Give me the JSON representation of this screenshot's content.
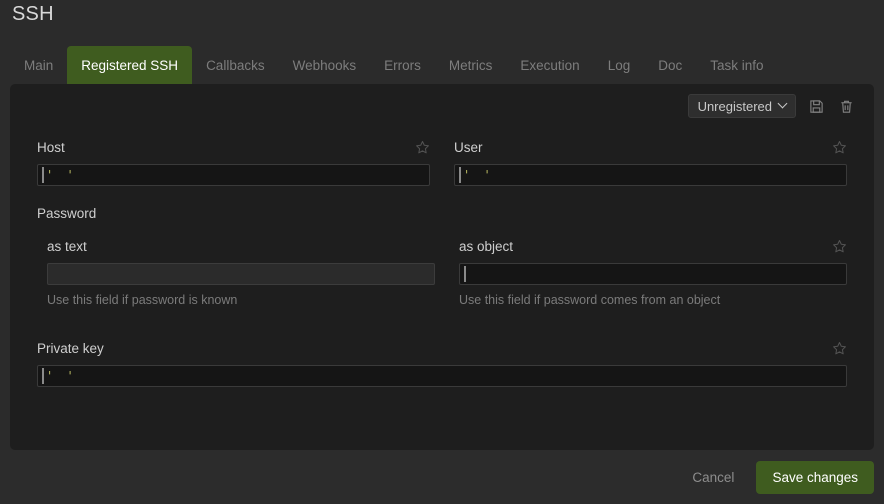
{
  "header": {
    "title": "SSH"
  },
  "tabs": [
    {
      "label": "Main",
      "active": false
    },
    {
      "label": "Registered SSH",
      "active": true
    },
    {
      "label": "Callbacks",
      "active": false
    },
    {
      "label": "Webhooks",
      "active": false
    },
    {
      "label": "Errors",
      "active": false
    },
    {
      "label": "Metrics",
      "active": false
    },
    {
      "label": "Execution",
      "active": false
    },
    {
      "label": "Log",
      "active": false
    },
    {
      "label": "Doc",
      "active": false
    },
    {
      "label": "Task info",
      "active": false
    }
  ],
  "toolbar": {
    "select_value": "Unregistered",
    "select_options": [
      "Unregistered"
    ],
    "save_icon": "floppy-disk-icon",
    "delete_icon": "trash-icon",
    "chevron_icon": "chevron-down-icon"
  },
  "form": {
    "host": {
      "label": "Host",
      "value": "' '",
      "favorite_icon": "star-outline-icon"
    },
    "user": {
      "label": "User",
      "value": "' '",
      "favorite_icon": "star-outline-icon"
    },
    "password": {
      "section_label": "Password",
      "as_text": {
        "label": "as text",
        "value": "",
        "placeholder": "",
        "helper": "Use this field if password is known"
      },
      "as_object": {
        "label": "as object",
        "value": "",
        "helper": "Use this field if password comes from an object",
        "favorite_icon": "star-outline-icon"
      }
    },
    "private_key": {
      "label": "Private key",
      "value": "' '",
      "favorite_icon": "star-outline-icon"
    }
  },
  "footer": {
    "cancel_label": "Cancel",
    "save_label": "Save changes"
  },
  "colors": {
    "page_background": "#2b2b2b",
    "panel_background": "#1e1e1e",
    "footer_background": "#2c2c2c",
    "accent_green": "#3f5c1f",
    "code_string": "#b5b560",
    "label_text": "#cfcfcf",
    "muted_text": "#7b7b7b"
  }
}
